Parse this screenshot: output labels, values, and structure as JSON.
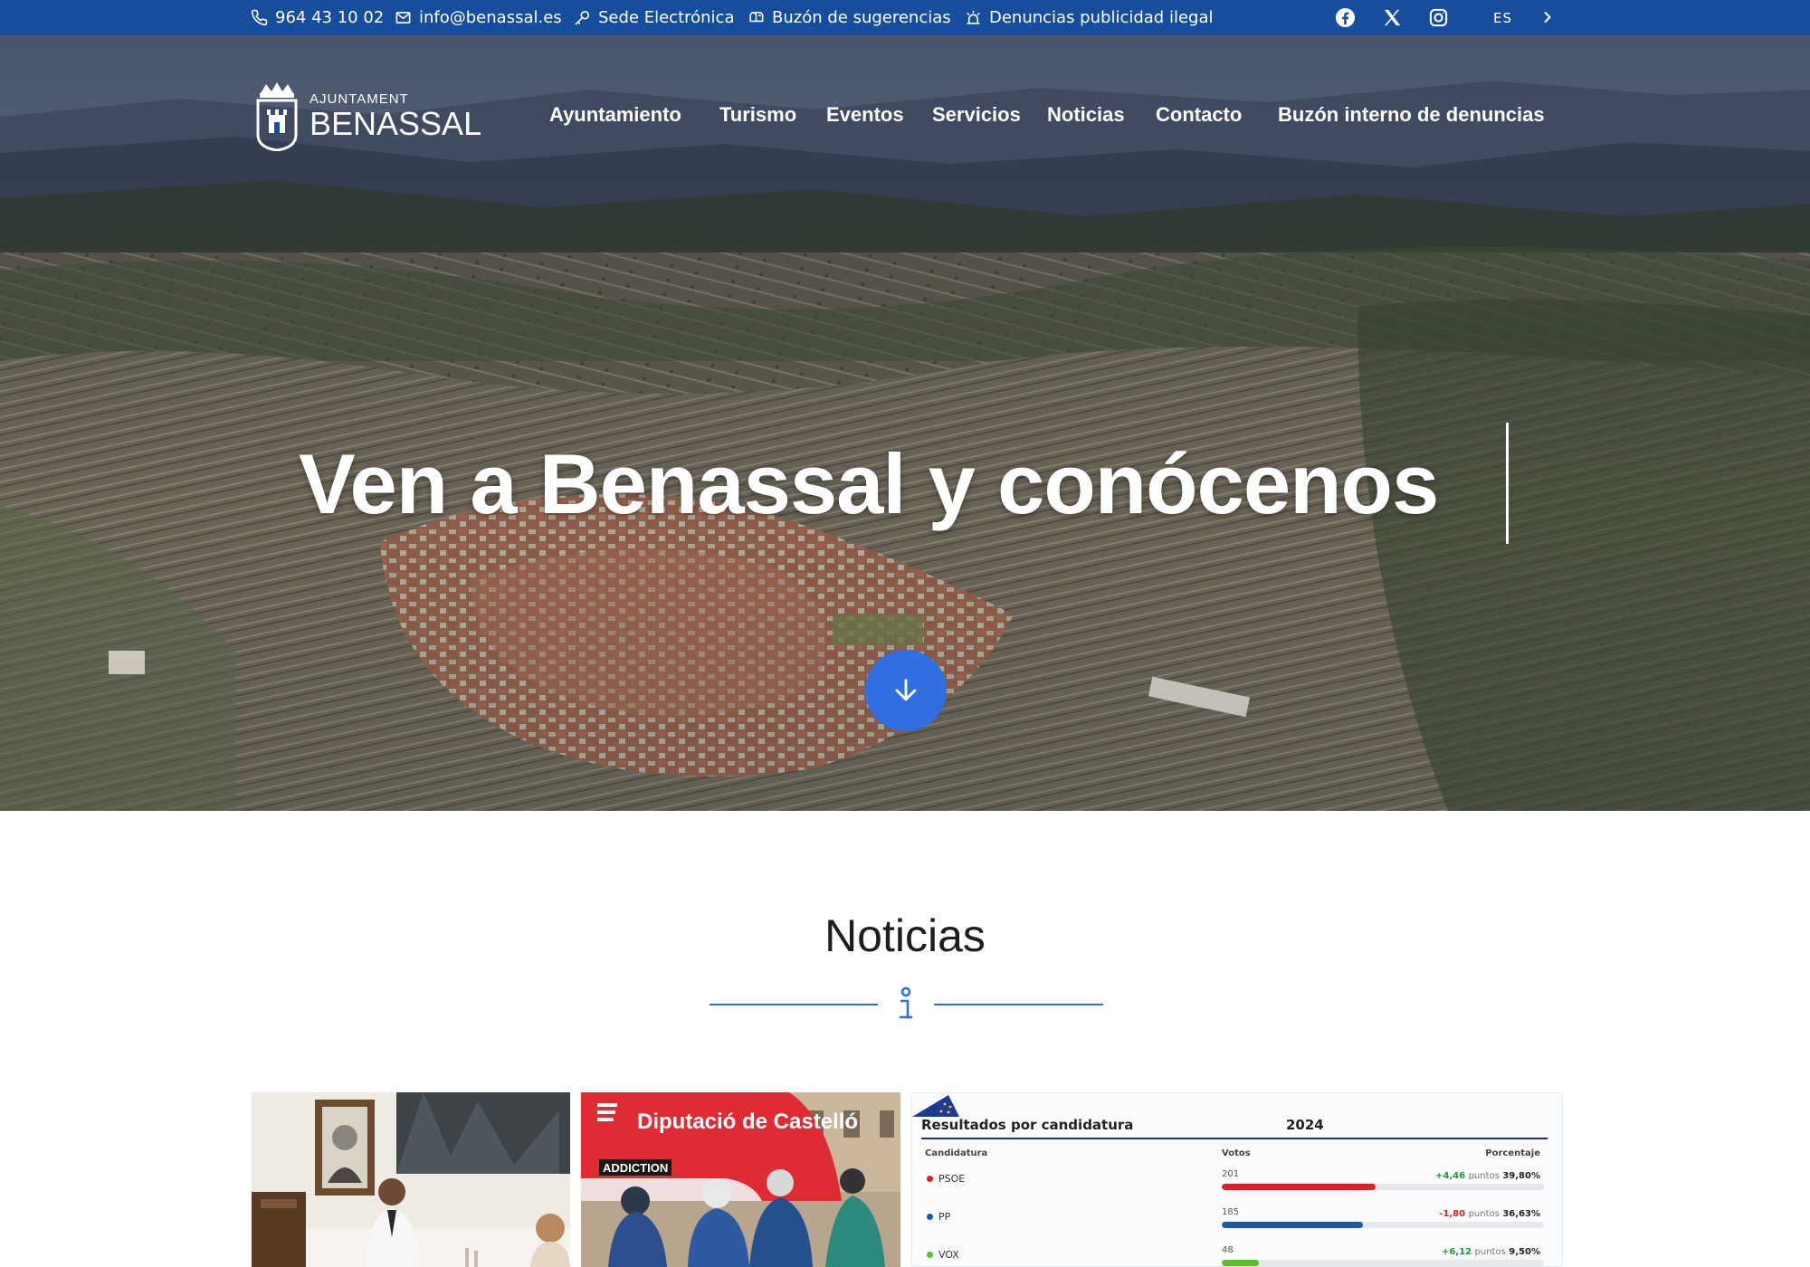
{
  "topbar": {
    "phone": "964 43 10 02",
    "email": "info@benassal.es",
    "sede": "Sede Electrónica",
    "buzon": "Buzón de sugerencias",
    "denuncias": "Denuncias publicidad ilegal",
    "lang": "ES",
    "colors": {
      "background": "#174d9d",
      "text": "#ffffff"
    },
    "social_icons": [
      "facebook-icon",
      "x-icon",
      "instagram-icon"
    ]
  },
  "logo": {
    "small": "AJUNTAMENT",
    "big": "BENASSAL"
  },
  "nav": {
    "items": [
      "Ayuntamiento",
      "Turismo",
      "Eventos",
      "Servicios",
      "Noticias",
      "Contacto",
      "Buzón interno de denuncias"
    ]
  },
  "hero": {
    "title": "Ven a Benassal y conócenos",
    "scroll_icon": "arrow-down-icon",
    "accent": "#2f6fe0"
  },
  "news": {
    "title": "Noticias",
    "icon": "info-icon",
    "cards": [
      {
        "image": "meeting-photo"
      },
      {
        "image": "cycling-race-photo",
        "banner": "Diputació de Castelló",
        "sign": "ADDICTION"
      },
      {
        "image": "election-results-card",
        "heading": "Resultados por candidatura",
        "year": "2024",
        "col_candidatura": "Candidatura",
        "col_votos": "Votos",
        "col_porcentaje": "Porcentaje",
        "rows": [
          {
            "name": "PSOE",
            "votes": "201",
            "delta": "+4,46",
            "pts": "puntos",
            "pct": "39,80%",
            "fraction": 0.398,
            "color": "#d52428",
            "delta_color": "#1f9a3a"
          },
          {
            "name": "PP",
            "votes": "185",
            "delta": "-1,80",
            "pts": "puntos",
            "pct": "36,63%",
            "fraction": 0.3663,
            "color": "#1c5aa8",
            "delta_color": "#d52428"
          },
          {
            "name": "VOX",
            "votes": "48",
            "delta": "+6,12",
            "pts": "puntos",
            "pct": "9,50%",
            "fraction": 0.095,
            "color": "#5bbf2c",
            "delta_color": "#1f9a3a"
          }
        ]
      }
    ]
  }
}
